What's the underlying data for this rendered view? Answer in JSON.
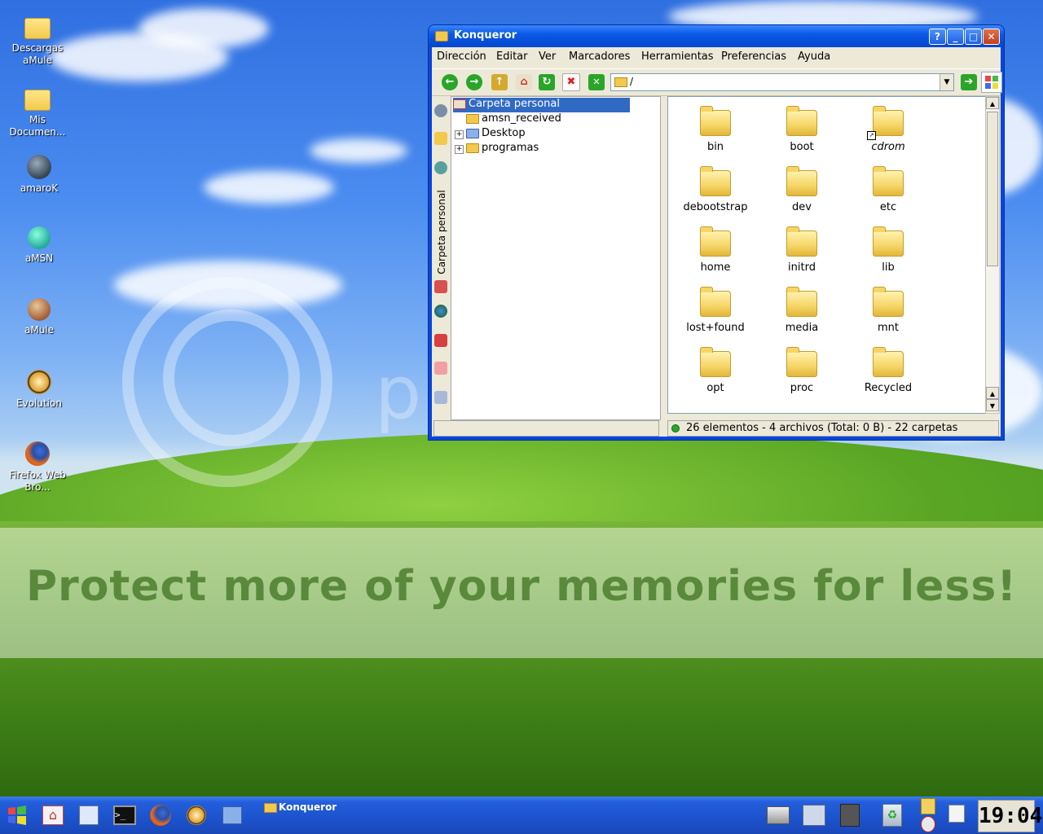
{
  "desktop": {
    "banner_text": "Protect more of your memories for less!",
    "watermark_text": "p",
    "icons": [
      {
        "label": "Descargas aMule",
        "icon": "folder-icon"
      },
      {
        "label": "Mis Documen...",
        "icon": "folder-icon"
      },
      {
        "label": "amaroK",
        "icon": "amarok-icon"
      },
      {
        "label": "aMSN",
        "icon": "amsn-icon"
      },
      {
        "label": "aMule",
        "icon": "amule-icon"
      },
      {
        "label": "Evolution",
        "icon": "evolution-icon"
      },
      {
        "label": "Firefox Web Bro...",
        "icon": "firefox-icon"
      }
    ]
  },
  "window": {
    "title": "Konqueror",
    "controls": {
      "help": "?",
      "minimize": "_",
      "maximize": "□",
      "close": "✕"
    },
    "menu": [
      "Dirección",
      "Editar",
      "Ver",
      "Marcadores",
      "Herramientas",
      "Preferencias",
      "Ayuda"
    ],
    "location": {
      "value": "/"
    },
    "sidebar_tab_label": "Carpeta personal",
    "tree": [
      {
        "label": "Carpeta personal",
        "selected": true
      },
      {
        "label": "amsn_received"
      },
      {
        "label": "Desktop"
      },
      {
        "label": "programas"
      }
    ],
    "files": [
      {
        "name": "bin"
      },
      {
        "name": "boot"
      },
      {
        "name": "cdrom",
        "link": true
      },
      {
        "name": "debootstrap"
      },
      {
        "name": "dev"
      },
      {
        "name": "etc"
      },
      {
        "name": "home"
      },
      {
        "name": "initrd"
      },
      {
        "name": "lib"
      },
      {
        "name": "lost+found"
      },
      {
        "name": "media"
      },
      {
        "name": "mnt"
      },
      {
        "name": "opt"
      },
      {
        "name": "proc"
      },
      {
        "name": "Recycled"
      }
    ],
    "status": "26 elementos - 4 archivos (Total: 0 B) - 22 carpetas"
  },
  "taskbar": {
    "task_label": "Konqueror",
    "clock": "19:04"
  },
  "colors": {
    "titlebar": "#0a5ae6",
    "selection": "#316ac5",
    "taskbar": "#245edb"
  }
}
